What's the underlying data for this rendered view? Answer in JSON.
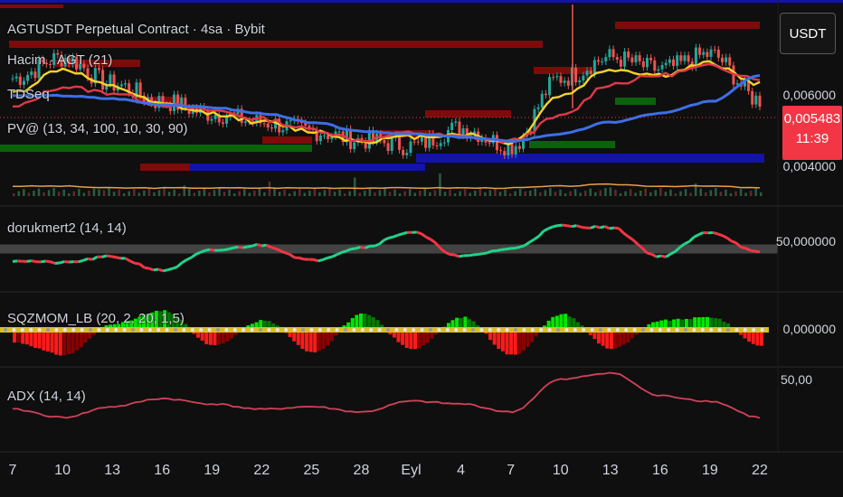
{
  "header": {
    "title": "AGTUSDT Perpetual Contract · 4sa · Bybit",
    "currency_button": "USDT"
  },
  "legends": {
    "volume": "Hacim · AGT (21)",
    "tdseq": "TDSeq",
    "pv": "PV@ (13, 34, 100, 10, 30, 90)",
    "dorukmert": "dorukmert2 (14, 14)",
    "sqzmom": "SQZMOM_LB (20, 2, 20, 1,5)",
    "adx": "ADX (14, 14)"
  },
  "price_axis": {
    "ticks": [
      "0,006000",
      "0,004000"
    ],
    "current_price": "0,005483",
    "countdown": "11:39"
  },
  "indicator_axes": {
    "dorukmert_level": "50,000000",
    "sqzmom_level": "0,000000",
    "adx_level": "50,00"
  },
  "x_ticks": [
    "7",
    "10",
    "13",
    "16",
    "19",
    "22",
    "25",
    "28",
    "Eyl",
    "4",
    "7",
    "10",
    "13",
    "16",
    "19",
    "22"
  ],
  "colors": {
    "background": "#0f0f0f",
    "price_red": "#f23645",
    "ema_yellow": "#f5d32a",
    "ema_red": "#e0394a",
    "ema_blue": "#3d6fe6",
    "green": "#22c55e",
    "bar_red": "#8b0a0a",
    "bar_green": "#0b6b0b",
    "bar_blue": "#1414b8"
  },
  "chart_data": [
    {
      "type": "line",
      "name": "price",
      "x": [
        "7",
        "10",
        "13",
        "16",
        "19",
        "22",
        "25",
        "28",
        "Eyl",
        "4",
        "7",
        "10",
        "13",
        "16",
        "19",
        "22"
      ],
      "series": [
        {
          "values": [
            0.00585,
            0.0062,
            0.00575,
            0.00545,
            0.00525,
            0.0051,
            0.00495,
            0.0048,
            0.0047,
            0.005,
            0.0047,
            0.00585,
            0.0062,
            0.006,
            0.00625,
            0.00548
          ]
        },
        {
          "values": [
            0.0056,
            0.006,
            0.0057,
            0.0054,
            0.00525,
            0.0051,
            0.00495,
            0.00478,
            0.00485,
            0.0049,
            0.00475,
            0.00555,
            0.006,
            0.0059,
            0.0061,
            0.00575
          ]
        },
        {
          "values": [
            0.00535,
            0.0057,
            0.0056,
            0.0054,
            0.0053,
            0.00515,
            0.00498,
            0.0048,
            0.00492,
            0.00485,
            0.00478,
            0.0052,
            0.00575,
            0.0059,
            0.00605,
            0.00585
          ]
        },
        {
          "values": [
            0.00555,
            0.00555,
            0.0055,
            0.0054,
            0.00535,
            0.00525,
            0.0051,
            0.00495,
            0.0049,
            0.00485,
            0.00478,
            0.0049,
            0.0051,
            0.00525,
            0.00545,
            0.0059
          ]
        }
      ],
      "ylim": [
        0.0038,
        0.0071
      ]
    },
    {
      "type": "line",
      "name": "dorukmert2",
      "x": [
        "7",
        "10",
        "13",
        "16",
        "19",
        "22",
        "25",
        "28",
        "Eyl",
        "4",
        "7",
        "10",
        "13",
        "16",
        "19",
        "22"
      ],
      "values": [
        35,
        32,
        40,
        22,
        48,
        55,
        35,
        52,
        72,
        40,
        50,
        80,
        78,
        40,
        72,
        45
      ],
      "ylim": [
        0,
        100
      ]
    },
    {
      "type": "bar",
      "name": "sqzmom",
      "x": [
        "7",
        "10",
        "13",
        "16",
        "19",
        "22",
        "25",
        "28",
        "Eyl",
        "4",
        "7",
        "10",
        "13",
        "16",
        "19",
        "22"
      ],
      "values": [
        -0.4,
        -0.8,
        0.2,
        0.6,
        -0.5,
        0.3,
        -0.7,
        0.5,
        -0.6,
        0.4,
        -0.8,
        0.5,
        -0.6,
        0.3,
        0.4,
        -0.5
      ],
      "ylim": [
        -1,
        1
      ]
    },
    {
      "type": "line",
      "name": "ADX",
      "x": [
        "7",
        "10",
        "13",
        "16",
        "19",
        "22",
        "25",
        "28",
        "Eyl",
        "4",
        "7",
        "10",
        "13",
        "16",
        "19",
        "22"
      ],
      "values": [
        28,
        22,
        30,
        36,
        32,
        28,
        30,
        26,
        34,
        32,
        26,
        50,
        55,
        38,
        34,
        22
      ],
      "ylim": [
        0,
        60
      ]
    }
  ]
}
